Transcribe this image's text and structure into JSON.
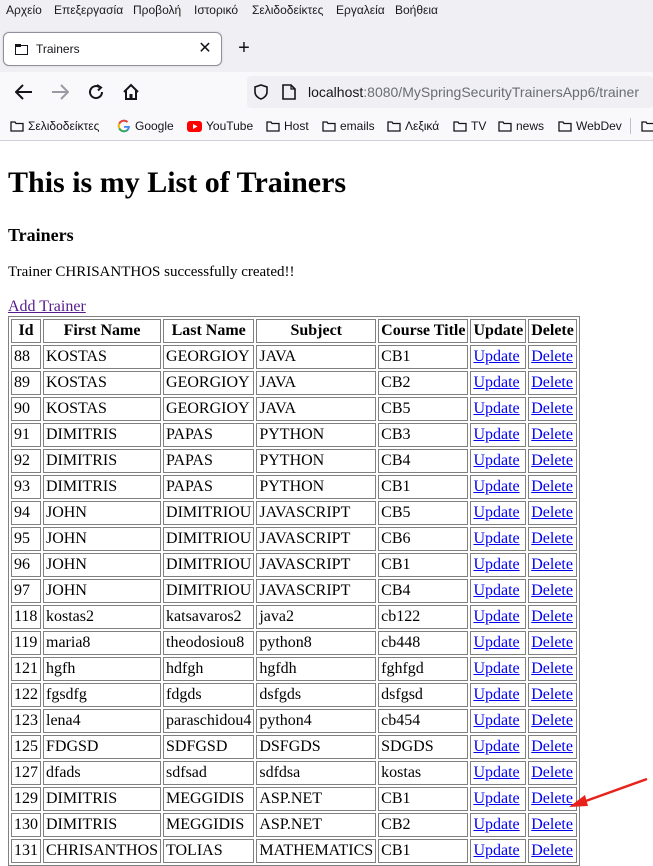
{
  "menu": [
    "Αρχείο",
    "Επεξεργασία",
    "Προβολή",
    "Ιστορικό",
    "Σελιδοδείκτες",
    "Εργαλεία",
    "Βοήθεια"
  ],
  "tab": {
    "title": "Trainers"
  },
  "address": {
    "host": "localhost",
    "rest": ":8080/MySpringSecurityTrainersApp6/trainer"
  },
  "bookmarks": [
    "Σελιδοδείκτες",
    "Google",
    "YouTube",
    "Host",
    "emails",
    "Λεξικά",
    "TV",
    "news",
    "WebDev"
  ],
  "page": {
    "heading": "This is my List of Trainers",
    "subheading": "Trainers",
    "message": "Trainer CHRISANTHOS successfully created!!",
    "add_link": "Add Trainer"
  },
  "table": {
    "headers": [
      "Id",
      "First Name",
      "Last Name",
      "Subject",
      "Course Title",
      "Update",
      "Delete"
    ],
    "update_label": "Update",
    "delete_label": "Delete",
    "rows": [
      [
        "88",
        "KOSTAS",
        "GEORGIOY",
        "JAVA",
        "CB1"
      ],
      [
        "89",
        "KOSTAS",
        "GEORGIOY",
        "JAVA",
        "CB2"
      ],
      [
        "90",
        "KOSTAS",
        "GEORGIOY",
        "JAVA",
        "CB5"
      ],
      [
        "91",
        "DIMITRIS",
        "PAPAS",
        "PYTHON",
        "CB3"
      ],
      [
        "92",
        "DIMITRIS",
        "PAPAS",
        "PYTHON",
        "CB4"
      ],
      [
        "93",
        "DIMITRIS",
        "PAPAS",
        "PYTHON",
        "CB1"
      ],
      [
        "94",
        "JOHN",
        "DIMITRIOU",
        "JAVASCRIPT",
        "CB5"
      ],
      [
        "95",
        "JOHN",
        "DIMITRIOU",
        "JAVASCRIPT",
        "CB6"
      ],
      [
        "96",
        "JOHN",
        "DIMITRIOU",
        "JAVASCRIPT",
        "CB1"
      ],
      [
        "97",
        "JOHN",
        "DIMITRIOU",
        "JAVASCRIPT",
        "CB4"
      ],
      [
        "118",
        "kostas2",
        "katsavaros2",
        "java2",
        "cb122"
      ],
      [
        "119",
        "maria8",
        "theodosiou8",
        "python8",
        "cb448"
      ],
      [
        "121",
        "hgfh",
        "hdfgh",
        "hgfdh",
        "fghfgd"
      ],
      [
        "122",
        "fgsdfg",
        "fdgds",
        "dsfgds",
        "dsfgsd"
      ],
      [
        "123",
        "lena4",
        "paraschidou4",
        "python4",
        "cb454"
      ],
      [
        "125",
        "FDGSD",
        "SDFGSD",
        "DSFGDS",
        "SDGDS"
      ],
      [
        "127",
        "dfads",
        "sdfsad",
        "sdfdsa",
        "kostas"
      ],
      [
        "129",
        "DIMITRIS",
        "MEGGIDIS",
        "ASP.NET",
        "CB1"
      ],
      [
        "130",
        "DIMITRIS",
        "MEGGIDIS",
        "ASP.NET",
        "CB2"
      ],
      [
        "131",
        "CHRISANTHOS",
        "TOLIAS",
        "MATHEMATICS",
        "CB1"
      ]
    ]
  },
  "colors": {
    "link": "#0000ee",
    "visited": "#551a8b",
    "annotation": "#e8221b",
    "chrome": "#f0f0f4"
  }
}
